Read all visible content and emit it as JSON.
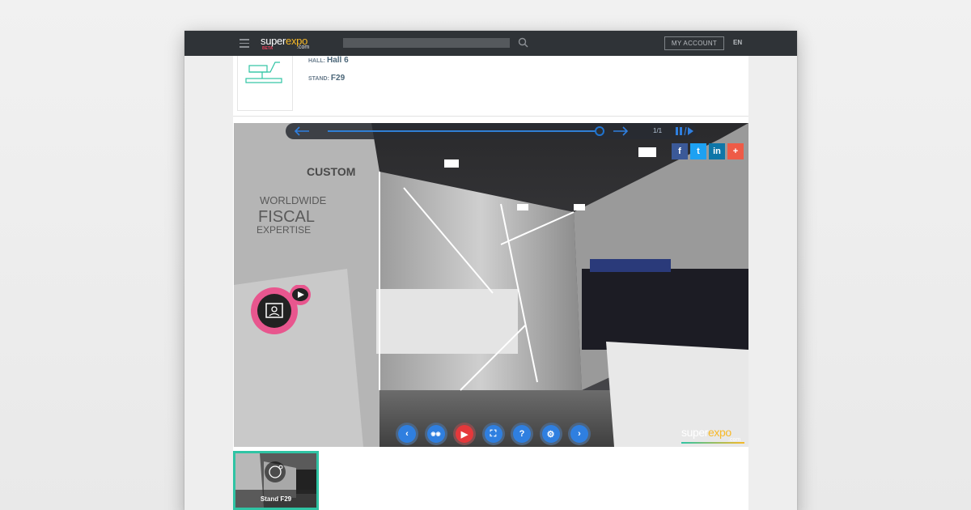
{
  "app": {
    "logo_text_a": "super",
    "logo_text_b": "expo",
    "logo_suffix": ".com",
    "logo_badge": "BETA"
  },
  "topbar": {
    "search_value": "",
    "account_label": "MY ACCOUNT",
    "language": "EN"
  },
  "stand_info": {
    "hall_label": "HALL:",
    "hall_value": "Hall 6",
    "stand_label": "STAND:",
    "stand_value": "F29"
  },
  "viewer": {
    "pager": "1/1",
    "progress": 1.0,
    "share": {
      "facebook": "f",
      "twitter": "t",
      "linkedin": "in",
      "more": "+"
    },
    "controls": [
      {
        "name": "prev-button",
        "glyph": "‹"
      },
      {
        "name": "vr-button",
        "glyph": "◉◉"
      },
      {
        "name": "play-button",
        "glyph": "▶"
      },
      {
        "name": "fullscreen-button",
        "glyph": "⛶"
      },
      {
        "name": "help-button",
        "glyph": "?"
      },
      {
        "name": "gyro-button",
        "glyph": "⚙"
      },
      {
        "name": "next-button",
        "glyph": "›"
      }
    ],
    "watermark_a": "super",
    "watermark_b": "expo",
    "watermark_suffix": ".com"
  },
  "thumbnails": [
    {
      "label": "Stand F29",
      "selected": true
    }
  ],
  "colors": {
    "topbar": "#2f3337",
    "accent_blue": "#2f7fe0",
    "accent_red": "#e5383b",
    "thumb_border": "#2fc4a4",
    "brand_yellow": "#f7b928",
    "hotspot_pink": "#e8568e"
  }
}
